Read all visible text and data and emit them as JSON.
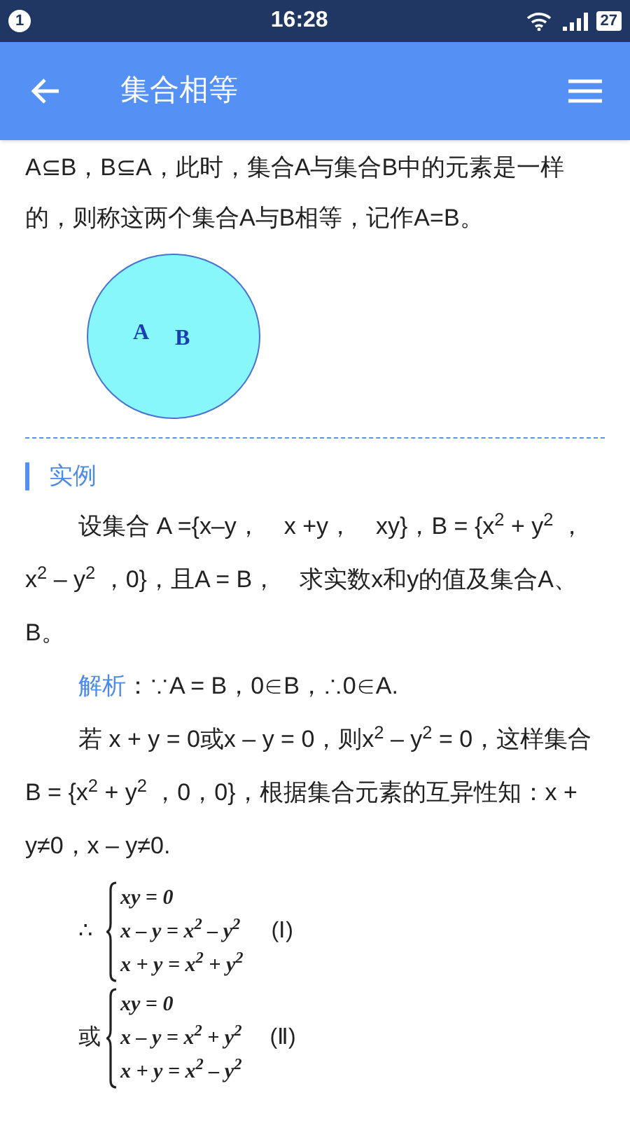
{
  "status_bar": {
    "notification": "1",
    "time": "16:28",
    "battery": "27"
  },
  "app_bar": {
    "title": "集合相等"
  },
  "intro": "A⊆B，B⊆A，此时，集合A与集合B中的元素是一样的，则称这两个集合A与B相等，记作A=B。",
  "diagram": {
    "labels": [
      "A",
      "B"
    ]
  },
  "section": {
    "title": "实例"
  },
  "problem": "设集合 A ={x–y，　x +y，　xy}，B = {x$^{2}$ + y$^{2}$ ，x$^{2}$ – y$^{2}$ ，0}，且A = B，　求实数x和y的值及集合A、B。",
  "analysis": {
    "label": "解析",
    "text": "：∵A = B，0∈B，∴0∈A."
  },
  "reasoning": "若 x + y = 0或x – y = 0，则x$^{2}$ – y$^{2}$ = 0，这样集合B = {x$^{2}$ + y$^{2}$ ，0，0}，根据集合元素的互异性知：x + y≠0，x – y≠0.",
  "systems": [
    {
      "prefix": "∴",
      "lines": [
        "xy = 0",
        "x – y = x$^{2}$ – y$^{2}$",
        "x + y = x$^{2}$ + y$^{2}$"
      ],
      "tag": "(Ⅰ)"
    },
    {
      "prefix": "或",
      "lines": [
        "xy = 0",
        "x – y = x$^{2}$ + y$^{2}$",
        "x + y = x$^{2}$ – y$^{2}$"
      ],
      "tag": "(Ⅱ)"
    }
  ]
}
